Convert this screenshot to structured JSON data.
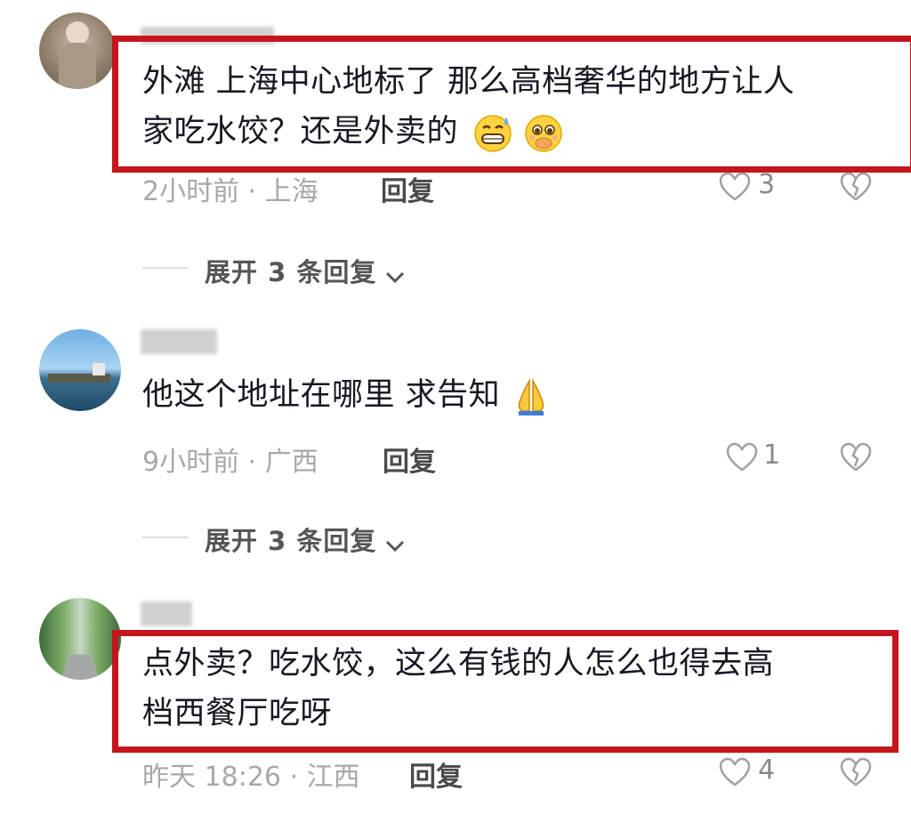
{
  "comments": [
    {
      "text_lines": [
        "外滩 上海中心地标了 那么高档奢华的地方让人",
        "家吃水饺？还是外卖的"
      ],
      "emojis": [
        "grin-sweat-emoji",
        "pleading-emoji"
      ],
      "meta": "2小时前 · 上海",
      "reply_label": "回复",
      "like_count": "3",
      "expand_label": "展开 3 条回复"
    },
    {
      "text_lines": [
        "他这个地址在哪里 求告知"
      ],
      "emojis": [
        "pray-hands-emoji"
      ],
      "meta": "9小时前 · 广西",
      "reply_label": "回复",
      "like_count": "1",
      "expand_label": "展开 3 条回复"
    },
    {
      "text_lines": [
        "点外卖？吃水饺，这么有钱的人怎么也得去高",
        "档西餐厅吃呀"
      ],
      "emojis": [],
      "meta": "昨天 18:26 · 江西",
      "reply_label": "回复",
      "like_count": "4"
    }
  ],
  "icons": {
    "like": "heart-outline-icon",
    "dislike": "broken-heart-icon",
    "expand": "chevron-down-icon"
  },
  "colors": {
    "highlight_border": "#c4161c",
    "meta_text": "#a8a8a8"
  }
}
